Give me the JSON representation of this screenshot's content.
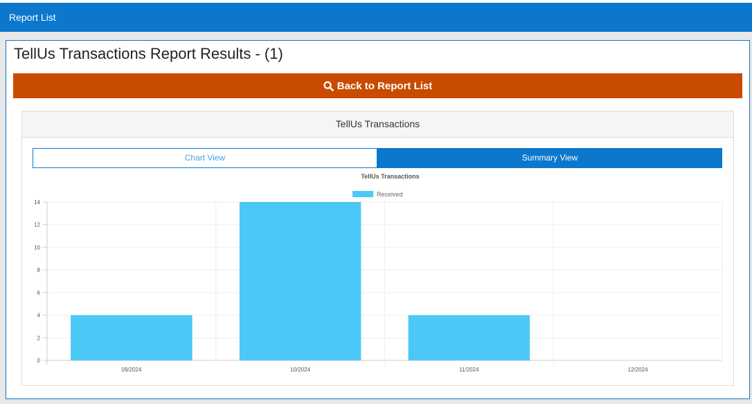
{
  "header": {
    "title": "Report List"
  },
  "page": {
    "title": "TellUs Transactions Report Results - (1)",
    "back_label": "Back to Report List"
  },
  "card": {
    "title": "TellUs Transactions",
    "tabs": [
      {
        "label": "Chart View",
        "active": false
      },
      {
        "label": "Summary View",
        "active": true
      }
    ]
  },
  "colors": {
    "topbar": "#0c78cd",
    "back_button": "#c84b00",
    "bar": "#4bc8f5"
  },
  "chart_data": {
    "type": "bar",
    "title": "TellUs Transactions",
    "categories": [
      "09/2024",
      "10/2024",
      "11/2024",
      "12/2024"
    ],
    "series": [
      {
        "name": "Received",
        "values": [
          4,
          14,
          4,
          0
        ],
        "color": "#4bc8f5"
      }
    ],
    "ylim": [
      0,
      14
    ],
    "yticks": [
      0,
      2,
      4,
      6,
      8,
      10,
      12,
      14
    ],
    "legend": "top-center",
    "grid": true
  }
}
